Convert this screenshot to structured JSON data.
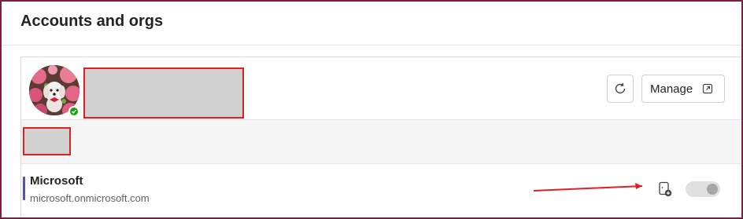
{
  "section": {
    "title": "Accounts and orgs"
  },
  "account": {
    "avatar_alt": "user-avatar",
    "presence": "available",
    "actions": {
      "refresh_icon": "refresh-icon",
      "manage_label": "Manage",
      "manage_icon": "open-external-icon"
    }
  },
  "org": {
    "name": "Microsoft",
    "domain": "microsoft.onmicrosoft.com",
    "status_icon": "device-add-icon",
    "toggle_on": false
  },
  "colors": {
    "accent": "#4f52b2",
    "presence": "#13a10e",
    "annotation": "#e02020",
    "frame": "#7a1f3d"
  }
}
